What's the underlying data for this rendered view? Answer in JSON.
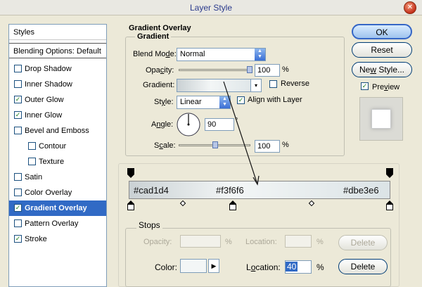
{
  "window": {
    "title": "Layer Style"
  },
  "sidebar": {
    "styles_label": "Styles",
    "blending_label": "Blending Options: Default",
    "items": [
      {
        "label": "Drop Shadow",
        "checked": false
      },
      {
        "label": "Inner Shadow",
        "checked": false
      },
      {
        "label": "Outer Glow",
        "checked": true
      },
      {
        "label": "Inner Glow",
        "checked": true
      },
      {
        "label": "Bevel and Emboss",
        "checked": false
      },
      {
        "label": "Contour",
        "checked": false
      },
      {
        "label": "Texture",
        "checked": false
      },
      {
        "label": "Satin",
        "checked": false
      },
      {
        "label": "Color Overlay",
        "checked": false
      },
      {
        "label": "Gradient Overlay",
        "checked": true
      },
      {
        "label": "Pattern Overlay",
        "checked": false
      },
      {
        "label": "Stroke",
        "checked": true
      }
    ]
  },
  "gradient_overlay": {
    "section_title": "Gradient Overlay",
    "subgroup_title": "Gradient",
    "blend_mode": {
      "label_pre": "Blend Mo",
      "label_u": "d",
      "label_post": "e:",
      "value": "Normal"
    },
    "opacity": {
      "label_pre": "Opa",
      "label_u": "c",
      "label_post": "ity:",
      "value": "100",
      "unit": "%",
      "level": 1.0
    },
    "gradient": {
      "label": "Gradient:",
      "reverse_label": "Reverse",
      "reverse_checked": false
    },
    "style": {
      "label_pre": "St",
      "label_u": "y",
      "label_post": "le:",
      "value": "Linear",
      "align_label": "Align with Layer",
      "align_checked": true
    },
    "angle": {
      "label_pre": "A",
      "label_u": "n",
      "label_post": "gle:",
      "value": "90",
      "unit": "°"
    },
    "scale": {
      "label_pre": "S",
      "label_u": "c",
      "label_post": "ale:",
      "value": "100",
      "unit": "%",
      "level": 0.5
    }
  },
  "gradient_editor": {
    "stop_colors": [
      "#cad1d4",
      "#f3f6f6",
      "#dbe3e6"
    ],
    "stops_title": "Stops",
    "opacity_label": "Opacity:",
    "opacity_unit": "%",
    "location_label": "Location:",
    "location_unit": "%",
    "delete_label": "Delete",
    "color_label": "Color:",
    "location2_label_pre": "L",
    "location2_label_u": "o",
    "location2_label_post": "cation:",
    "location_value": "40",
    "location2_unit": "%",
    "delete2_label": "Delete"
  },
  "buttons": {
    "ok": "OK",
    "reset": "Reset",
    "new_style_pre": "Ne",
    "new_style_u": "w",
    "new_style_post": " Style...",
    "preview_pre": "Pre",
    "preview_u": "v",
    "preview_post": "iew",
    "preview_checked": true
  },
  "colors": {
    "accent": "#316ac5",
    "title_text": "#2a3a8c"
  }
}
